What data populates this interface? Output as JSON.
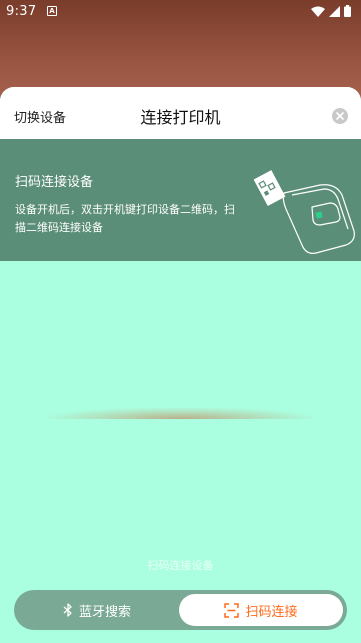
{
  "status": {
    "time": "9:37",
    "notification": "A"
  },
  "header": {
    "switch_label": "切换设备",
    "title": "连接打印机"
  },
  "banner": {
    "title": "扫码连接设备",
    "description": "设备开机后，双击开机键打印设备二维码，扫描二维码连接设备"
  },
  "scanner": {
    "hint": "扫码连接设备"
  },
  "tabs": [
    {
      "label": "蓝牙搜索",
      "icon": "bluetooth-icon",
      "active": false
    },
    {
      "label": "扫码连接",
      "icon": "scan-icon",
      "active": true
    }
  ],
  "colors": {
    "accent": "#ff6a1a",
    "banner": "#5b8e78",
    "sheet": "#aaffe0",
    "tab_bar": "#7aaa96"
  }
}
